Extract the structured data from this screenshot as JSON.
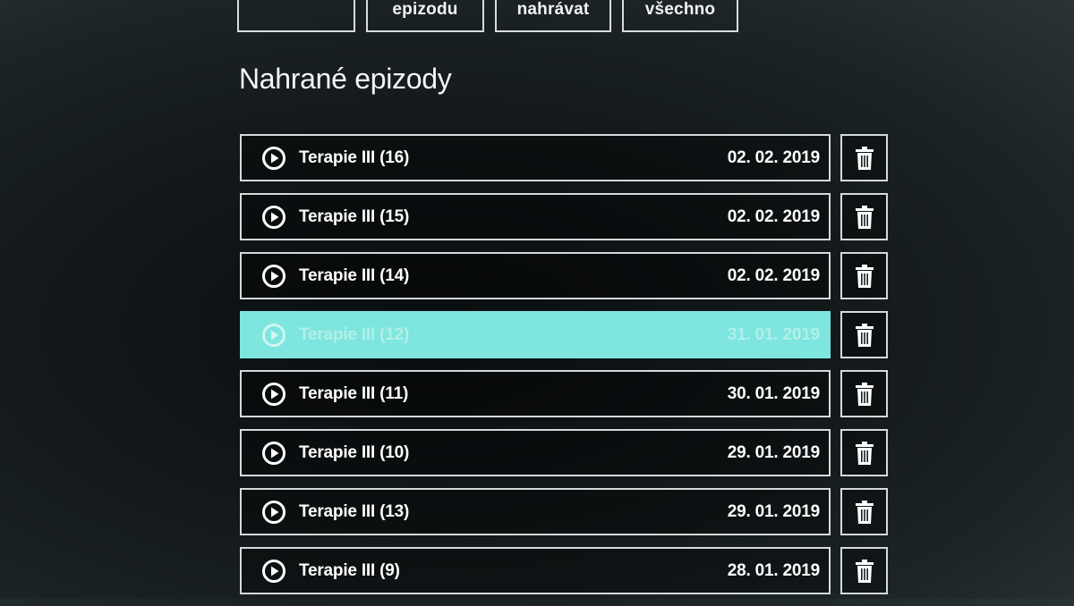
{
  "filters": [
    {
      "label": ""
    },
    {
      "label": "epizodu"
    },
    {
      "label": "nahrávat"
    },
    {
      "label": "všechno"
    }
  ],
  "page_title": "Nahrané epizody",
  "episodes": [
    {
      "title": "Terapie III (16)",
      "date": "02. 02. 2019",
      "selected": false
    },
    {
      "title": "Terapie III (15)",
      "date": "02. 02. 2019",
      "selected": false
    },
    {
      "title": "Terapie III (14)",
      "date": "02. 02. 2019",
      "selected": false
    },
    {
      "title": "Terapie III (12)",
      "date": "31. 01. 2019",
      "selected": true
    },
    {
      "title": "Terapie III (11)",
      "date": "30. 01. 2019",
      "selected": false
    },
    {
      "title": "Terapie III (10)",
      "date": "29. 01. 2019",
      "selected": false
    },
    {
      "title": "Terapie III (13)",
      "date": "29. 01. 2019",
      "selected": false
    },
    {
      "title": "Terapie III (9)",
      "date": "28. 01. 2019",
      "selected": false
    }
  ],
  "icons": {
    "play": "play-circle-icon",
    "delete": "trash-icon"
  },
  "colors": {
    "selection": "#7ee6de",
    "border": "#d6d9d9",
    "text": "#ffffff"
  }
}
